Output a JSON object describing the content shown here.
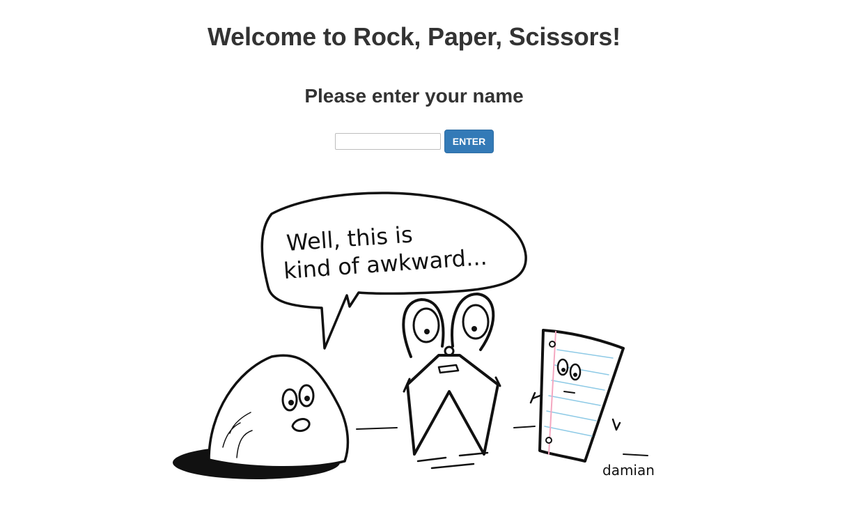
{
  "header": {
    "title": "Welcome to Rock, Paper, Scissors!",
    "subtitle": "Please enter your name"
  },
  "form": {
    "name_value": "",
    "enter_label": "ENTER"
  },
  "comic": {
    "speech_line1": "Well, this is",
    "speech_line2": "kind of awkward...",
    "signature": "damian"
  },
  "colors": {
    "button_bg": "#337ab7",
    "text": "#333333",
    "paper_lines": "#8ecae6",
    "paper_margin": "#f4a7c0"
  }
}
